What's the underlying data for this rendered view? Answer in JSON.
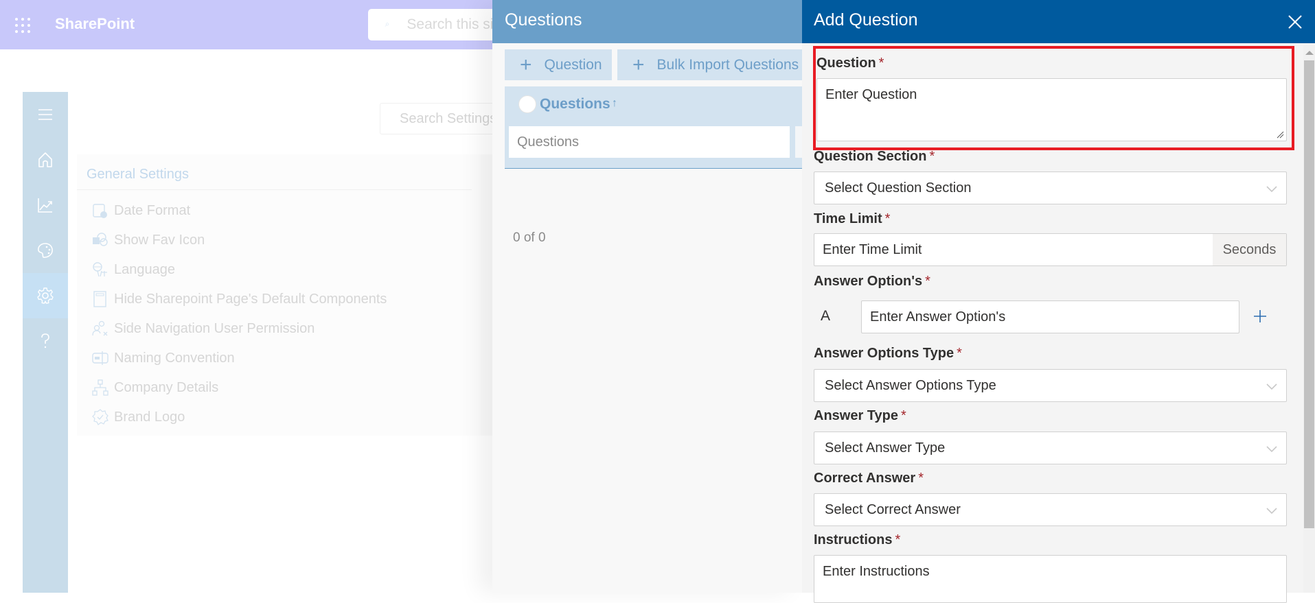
{
  "topbar": {
    "app_name": "SharePoint",
    "search_placeholder": "Search this site"
  },
  "leftnav": {
    "items": [
      {
        "name": "menu",
        "icon": "hamburger-icon"
      },
      {
        "name": "home",
        "icon": "home-icon"
      },
      {
        "name": "analytics",
        "icon": "chart-icon"
      },
      {
        "name": "theme",
        "icon": "palette-icon"
      },
      {
        "name": "settings",
        "icon": "gear-icon",
        "active": true
      },
      {
        "name": "help",
        "icon": "help-icon"
      }
    ]
  },
  "settings_page": {
    "search_placeholder": "Search Settings",
    "general": {
      "title": "General Settings",
      "items": [
        {
          "label": "Date Format",
          "icon": "calendar-clock-icon"
        },
        {
          "label": "Show Fav Icon",
          "icon": "sharepoint-icon"
        },
        {
          "label": "Language",
          "icon": "translate-icon"
        },
        {
          "label": "Hide Sharepoint Page's Default Components",
          "icon": "page-icon"
        },
        {
          "label": "Side Navigation User Permission",
          "icon": "users-permission-icon"
        },
        {
          "label": "Naming Convention",
          "icon": "rename-icon"
        },
        {
          "label": "Company Details",
          "icon": "org-chart-icon"
        },
        {
          "label": "Brand Logo",
          "icon": "verified-badge-icon"
        }
      ]
    }
  },
  "questions_panel": {
    "title": "Questions",
    "add_button": "Question",
    "bulk_import_button": "Bulk Import Questions",
    "column_header": "Questions",
    "sort_indicator": "↑",
    "filter_placeholder": "Questions",
    "count_text": "0 of 0"
  },
  "add_question_panel": {
    "title": "Add Question",
    "required_marker": "*",
    "fields": {
      "question": {
        "label": "Question",
        "placeholder": "Enter Question"
      },
      "question_section": {
        "label": "Question Section",
        "placeholder": "Select Question Section"
      },
      "time_limit": {
        "label": "Time Limit",
        "placeholder": "Enter Time Limit",
        "suffix": "Seconds"
      },
      "answer_options": {
        "label": "Answer Option's",
        "letter": "A",
        "placeholder": "Enter Answer Option's"
      },
      "answer_options_type": {
        "label": "Answer Options Type",
        "placeholder": "Select Answer Options Type"
      },
      "answer_type": {
        "label": "Answer Type",
        "placeholder": "Select Answer Type"
      },
      "correct_answer": {
        "label": "Correct Answer",
        "placeholder": "Select Correct Answer"
      },
      "instructions": {
        "label": "Instructions",
        "placeholder": "Enter Instructions"
      }
    }
  },
  "colors": {
    "suite_bar": "#c8c8fa",
    "questions_header": "#6a9fc9",
    "add_question_header": "#005a9e",
    "highlight": "#e81c24",
    "required": "#a4262c"
  }
}
